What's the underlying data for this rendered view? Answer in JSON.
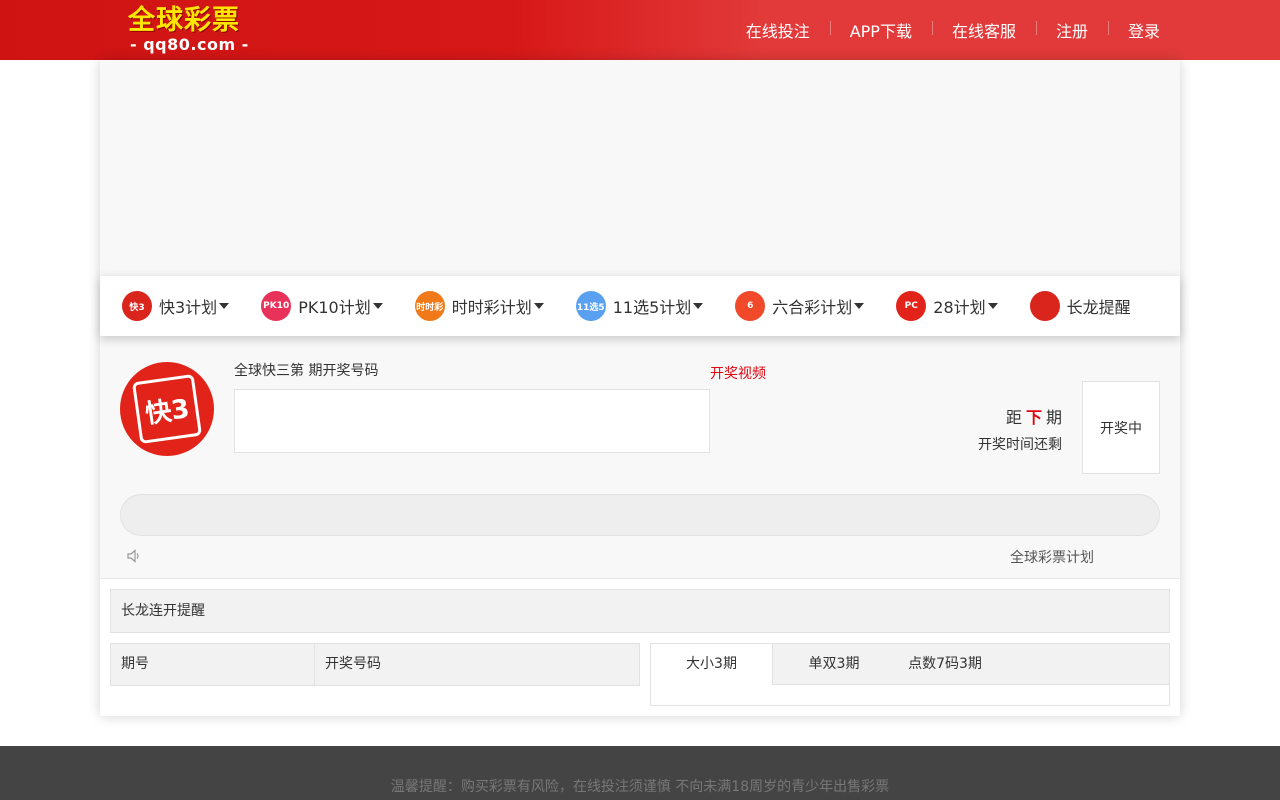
{
  "header": {
    "logo_title": "全球彩票",
    "logo_sub": "- qq80.com -",
    "nav": [
      {
        "label": "在线投注"
      },
      {
        "label": "APP下载"
      },
      {
        "label": "在线客服"
      },
      {
        "label": "注册"
      },
      {
        "label": "登录"
      }
    ]
  },
  "tabs": [
    {
      "label": "快3计划",
      "icon": "k3-icon",
      "icon_text": "快3",
      "color": "#d9251c",
      "dropdown": true
    },
    {
      "label": "PK10计划",
      "icon": "pk10-icon",
      "icon_text": "PK10",
      "color": "#e8325a",
      "dropdown": true
    },
    {
      "label": "时时彩计划",
      "icon": "ssc-icon",
      "icon_text": "时时彩",
      "color": "#f07a1a",
      "dropdown": true
    },
    {
      "label": "11选5计划",
      "icon": "11x5-icon",
      "icon_text": "11选5",
      "color": "#5aa0f0",
      "dropdown": true
    },
    {
      "label": "六合彩计划",
      "icon": "lhc-icon",
      "icon_text": "6",
      "color": "#f04a2a",
      "dropdown": true
    },
    {
      "label": "28计划",
      "icon": "pc28-icon",
      "icon_text": "PC",
      "color": "#e2231a",
      "dropdown": true
    },
    {
      "label": "长龙提醒",
      "icon": "dragon-icon",
      "icon_text": "",
      "color": "#d9251c",
      "dropdown": false
    }
  ],
  "lottery": {
    "logo_text": "快3",
    "issue_line": "全球快三第 期开奖号码",
    "video_link": "开奖视频",
    "next_prefix": "距",
    "next_highlight": "下",
    "next_suffix": "期",
    "remain_label": "开奖时间还剩",
    "status": "开奖中",
    "plan_link": "全球彩票计划"
  },
  "long_dragon": {
    "title": "长龙连开提醒"
  },
  "history_table": {
    "columns": [
      "期号",
      "开奖号码"
    ]
  },
  "stats_tabs": [
    {
      "label": "大小3期",
      "active": true
    },
    {
      "label": "单双3期",
      "active": false
    },
    {
      "label": "点数7码3期",
      "active": false
    }
  ],
  "footer": {
    "text": "温馨提醒：购买彩票有风险，在线投注须谨慎 不向未满18周岁的青少年出售彩票"
  }
}
